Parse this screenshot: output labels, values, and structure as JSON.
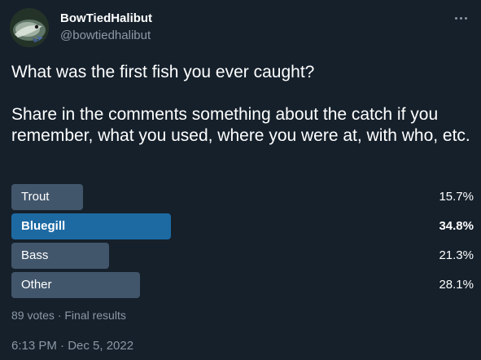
{
  "author": {
    "display_name": "BowTiedHalibut",
    "handle": "@bowtiedhalibut",
    "avatar_icon": "halibut-fish-avatar"
  },
  "tweet": {
    "question": "What was the first fish you ever caught?",
    "followup": "Share in the comments something about the catch if you remember, what you used, where you were at, with who, etc."
  },
  "poll": {
    "options": [
      {
        "label": "Trout",
        "percent_label": "15.7%",
        "percent": 15.7,
        "winner": false
      },
      {
        "label": "Bluegill",
        "percent_label": "34.8%",
        "percent": 34.8,
        "winner": true
      },
      {
        "label": "Bass",
        "percent_label": "21.3%",
        "percent": 21.3,
        "winner": false
      },
      {
        "label": "Other",
        "percent_label": "28.1%",
        "percent": 28.1,
        "winner": false
      }
    ],
    "summary": "89 votes · Final results"
  },
  "meta": {
    "timestamp": "6:13 PM · Dec 5, 2022"
  },
  "colors": {
    "background": "#15202b",
    "bar": "#42566b",
    "bar_winner": "#1d6aa3",
    "secondary_text": "#8b98a5"
  }
}
